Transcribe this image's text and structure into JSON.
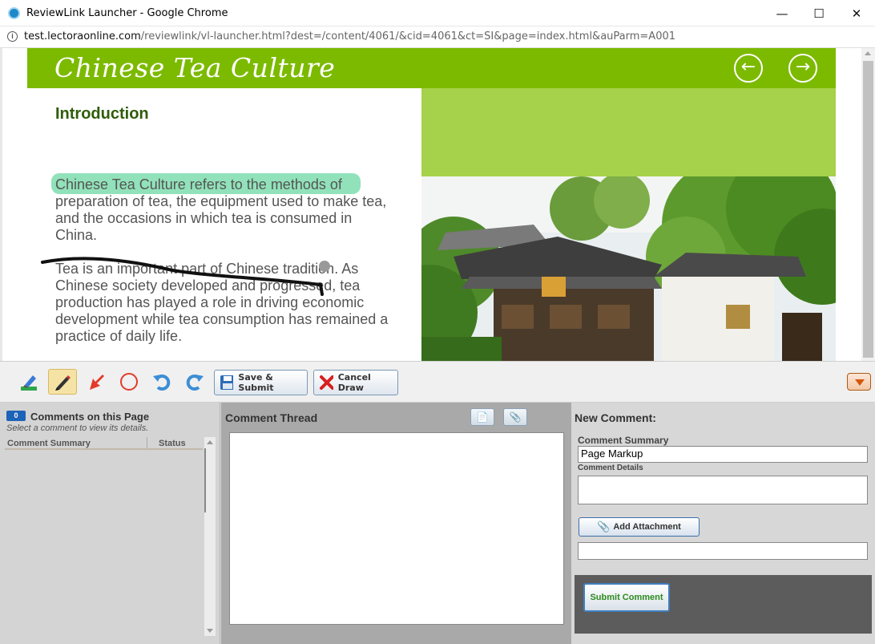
{
  "window": {
    "title": "ReviewLink Launcher - Google Chrome",
    "minimize": "—",
    "maximize": "☐",
    "close": "✕"
  },
  "address": {
    "host": "test.lectoraonline.com",
    "path": "/reviewlink/vl-launcher.html?dest=/content/4061/&cid=4061&ct=SI&page=index.html&auParm=A001"
  },
  "lesson": {
    "title": "Chinese Tea Culture",
    "prev_icon": "←",
    "next_icon": "→",
    "heading": "Introduction",
    "paragraph1": "Chinese Tea Culture refers to the methods of preparation of tea, the equipment used to make tea, and the occasions in which tea is consumed in China.",
    "paragraph2": "Tea is an important part of Chinese tradition. As Chinese society developed and progressed, tea production has played a role in driving economic development while tea consumption has remained a practice of daily life.",
    "highlight_color": "#8be0b6",
    "header_color": "#7cba00"
  },
  "toolbar": {
    "tools": [
      {
        "name": "highlighter",
        "icon": "highlighter-icon"
      },
      {
        "name": "pen",
        "icon": "pencil-icon",
        "active": true
      },
      {
        "name": "arrow",
        "icon": "arrow-icon"
      },
      {
        "name": "circle",
        "icon": "circle-icon"
      },
      {
        "name": "undo",
        "icon": "undo-icon"
      },
      {
        "name": "redo",
        "icon": "redo-icon"
      }
    ],
    "save_label": "Save & Submit",
    "cancel_label": "Cancel Draw"
  },
  "comments_panel": {
    "count": "0",
    "title": "Comments on this Page",
    "hint": "Select a comment to view its details.",
    "col_summary": "Comment Summary",
    "col_status": "Status"
  },
  "thread_panel": {
    "title": "Comment Thread"
  },
  "new_comment": {
    "title": "New Comment:",
    "summary_label": "Comment Summary",
    "summary_value": "Page Markup",
    "details_label": "Comment Details",
    "details_value": "",
    "attach_label": "Add Attachment",
    "attachment_value": "",
    "submit_label": "Submit Comment"
  }
}
